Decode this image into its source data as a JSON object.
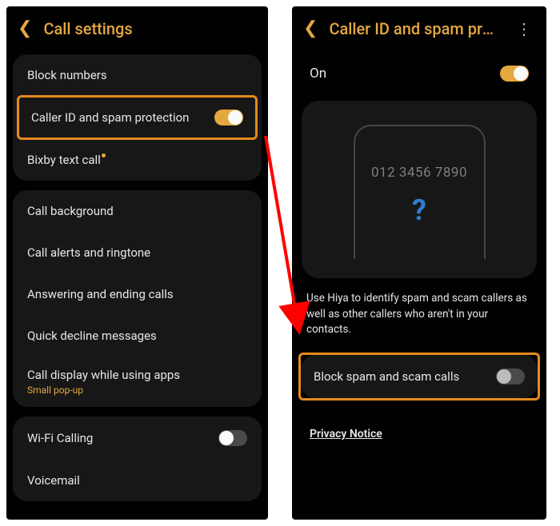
{
  "left": {
    "title": "Call settings",
    "group1": {
      "block_numbers": "Block numbers",
      "caller_id": "Caller ID and spam protection",
      "bixby": "Bixby text call"
    },
    "group2": {
      "call_bg": "Call background",
      "alerts": "Call alerts and ringtone",
      "answering": "Answering and ending calls",
      "decline": "Quick decline messages",
      "display": "Call display while using apps",
      "display_sub": "Small pop-up"
    },
    "group3": {
      "wifi": "Wi-Fi Calling",
      "voicemail": "Voicemail"
    }
  },
  "right": {
    "title": "Caller ID and spam pro…",
    "on_label": "On",
    "phone_number": "012 3456 7890",
    "desc": "Use Hiya to identify spam and scam callers as well as other callers who aren't in your contacts.",
    "block_label": "Block spam and scam calls",
    "privacy": "Privacy Notice"
  }
}
